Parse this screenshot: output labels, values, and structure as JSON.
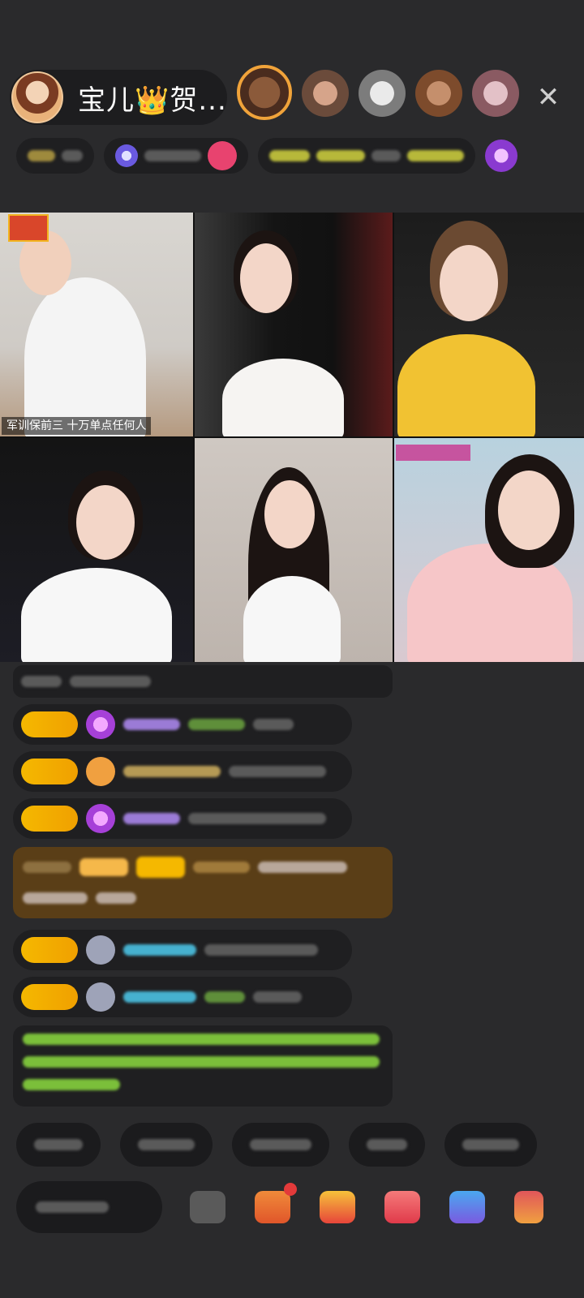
{
  "header": {
    "host_name": "宝儿👑贺...",
    "close_glyph": "✕"
  },
  "grid": {
    "tiles": [
      {
        "id": 1,
        "caption": "军训保前三  十万单点任何人"
      },
      {
        "id": 2,
        "caption": ""
      },
      {
        "id": 3,
        "caption": ""
      },
      {
        "id": 4,
        "caption": ""
      },
      {
        "id": 5,
        "caption": ""
      },
      {
        "id": 6,
        "caption": ""
      }
    ]
  },
  "colors": {
    "level_badge": "#f5b800",
    "special_msg_bg": "#5a3e17",
    "green_text": "#7bbf3a",
    "cyan_name": "#46b1cf",
    "purple_name": "#9b7bd6"
  },
  "icons": [
    "close-icon",
    "diamond-gift-icon",
    "heart-gift-icon",
    "bag-icon",
    "gift-box-icon",
    "fan-icon",
    "lottery-icon",
    "game-icon"
  ]
}
